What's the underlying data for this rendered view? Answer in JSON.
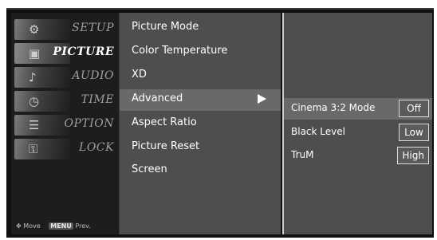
{
  "categories": [
    {
      "label": "SETUP",
      "icon": "setup-icon",
      "glyph": "⚙"
    },
    {
      "label": "PICTURE",
      "icon": "picture-icon",
      "glyph": "▣",
      "active": true
    },
    {
      "label": "AUDIO",
      "icon": "audio-icon",
      "glyph": "♪"
    },
    {
      "label": "TIME",
      "icon": "clock-icon",
      "glyph": "◷"
    },
    {
      "label": "OPTION",
      "icon": "option-icon",
      "glyph": "☰"
    },
    {
      "label": "LOCK",
      "icon": "lock-icon",
      "glyph": "⚿"
    }
  ],
  "footer": {
    "move_label": "Move",
    "menu_key": "MENU",
    "prev_label": "Prev."
  },
  "picture_menu": {
    "items": [
      "Picture Mode",
      "Color Temperature",
      "XD",
      "Advanced",
      "Aspect Ratio",
      "Picture Reset",
      "Screen"
    ],
    "selected": "Advanced"
  },
  "advanced_menu": {
    "items": [
      {
        "label": "Cinema 3:2 Mode",
        "value": "Off"
      },
      {
        "label": "Black Level",
        "value": "Low"
      },
      {
        "label": "TruM",
        "value": "High"
      }
    ],
    "selected": "Cinema 3:2 Mode"
  },
  "colors": {
    "background": "#101010",
    "panel": "#4e4e4e",
    "selection": "#696969",
    "text": "#ffffff"
  }
}
